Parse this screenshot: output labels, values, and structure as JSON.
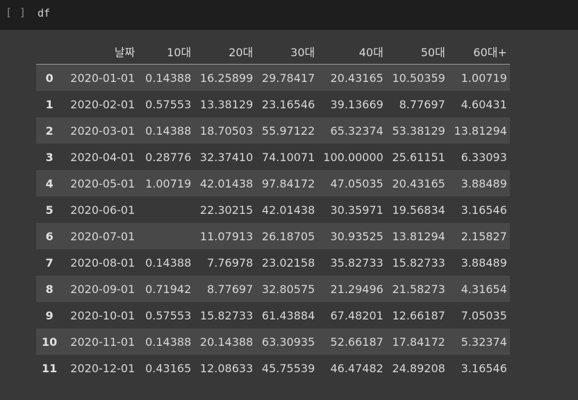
{
  "cell": {
    "run_indicator": "[ ]",
    "code": "df"
  },
  "table": {
    "columns": [
      "",
      "날짜",
      "10대",
      "20대",
      "30대",
      "40대",
      "50대",
      "60대+"
    ],
    "rows": [
      [
        "0",
        "2020-01-01",
        "0.14388",
        "16.25899",
        "29.78417",
        "20.43165",
        "10.50359",
        "1.00719"
      ],
      [
        "1",
        "2020-02-01",
        "0.57553",
        "13.38129",
        "23.16546",
        "39.13669",
        "8.77697",
        "4.60431"
      ],
      [
        "2",
        "2020-03-01",
        "0.14388",
        "18.70503",
        "55.97122",
        "65.32374",
        "53.38129",
        "13.81294"
      ],
      [
        "3",
        "2020-04-01",
        "0.28776",
        "32.37410",
        "74.10071",
        "100.00000",
        "25.61151",
        "6.33093"
      ],
      [
        "4",
        "2020-05-01",
        "1.00719",
        "42.01438",
        "97.84172",
        "47.05035",
        "20.43165",
        "3.88489"
      ],
      [
        "5",
        "2020-06-01",
        "",
        "22.30215",
        "42.01438",
        "30.35971",
        "19.56834",
        "3.16546"
      ],
      [
        "6",
        "2020-07-01",
        "",
        "11.07913",
        "26.18705",
        "30.93525",
        "13.81294",
        "2.15827"
      ],
      [
        "7",
        "2020-08-01",
        "0.14388",
        "7.76978",
        "23.02158",
        "35.82733",
        "15.82733",
        "3.88489"
      ],
      [
        "8",
        "2020-09-01",
        "0.71942",
        "8.77697",
        "32.80575",
        "21.29496",
        "21.58273",
        "4.31654"
      ],
      [
        "9",
        "2020-10-01",
        "0.57553",
        "15.82733",
        "61.43884",
        "67.48201",
        "12.66187",
        "7.05035"
      ],
      [
        "10",
        "2020-11-01",
        "0.14388",
        "20.14388",
        "63.30935",
        "52.66187",
        "17.84172",
        "5.32374"
      ],
      [
        "11",
        "2020-12-01",
        "0.43165",
        "12.08633",
        "45.75539",
        "46.47482",
        "24.89208",
        "3.16546"
      ]
    ]
  }
}
